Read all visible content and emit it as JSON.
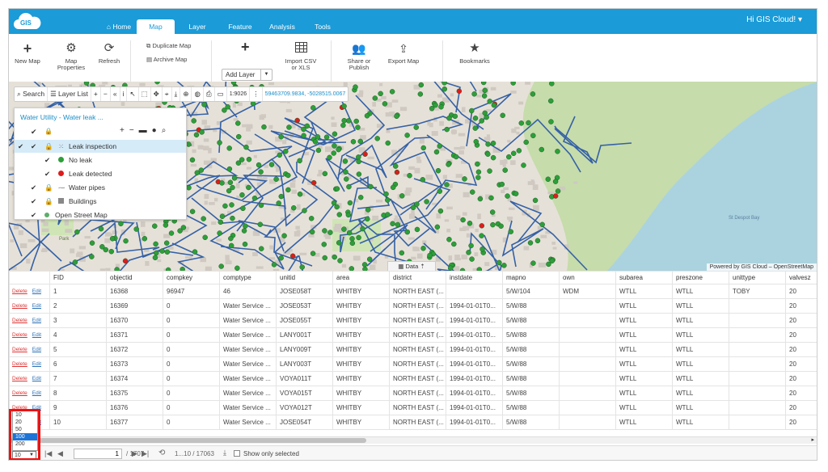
{
  "app": {
    "logo": "GIS",
    "user": "Hi GIS Cloud! ▾"
  },
  "nav": [
    {
      "label": "Home",
      "icon": "home-icon"
    },
    {
      "label": "Map"
    },
    {
      "label": "Layer"
    },
    {
      "label": "Feature"
    },
    {
      "label": "Analysis"
    },
    {
      "label": "Tools"
    }
  ],
  "ribbon": {
    "new_map": "New Map",
    "map_properties": "Map Properties",
    "refresh": "Refresh",
    "duplicate_map": "Duplicate Map",
    "archive_map": "Archive Map",
    "add_layer": "Add Layer",
    "import_csv": "Import CSV or XLS",
    "share": "Share or Publish",
    "export_map": "Export Map",
    "bookmarks": "Bookmarks"
  },
  "toolbar": {
    "search": "Search",
    "layer_list": "Layer List",
    "scale": "1:9026",
    "coords": "59463709.9834, -5028515.0067"
  },
  "layers": {
    "title": "Water Utility - Water leak ...",
    "items": [
      {
        "label": "Leak inspection"
      },
      {
        "label": "No leak",
        "color": "#2e9e3a"
      },
      {
        "label": "Leak detected",
        "color": "#dd1c1c"
      },
      {
        "label": "Water pipes"
      },
      {
        "label": "Buildings"
      },
      {
        "label": "Open Street Map"
      }
    ]
  },
  "map": {
    "credit": "Powered by GIS Cloud – OpenStreetMap",
    "data_tab": "Data",
    "park": "Park",
    "bay": "St Despot Bay"
  },
  "table": {
    "columns": [
      "FID",
      "objectid",
      "compkey",
      "comptype",
      "unitid",
      "area",
      "district",
      "instdate",
      "mapno",
      "own",
      "subarea",
      "preszone",
      "unittype",
      "valvesz"
    ],
    "actions": {
      "delete": "Delete",
      "edit": "Edit"
    },
    "rows": [
      [
        "1",
        "16368",
        "96947",
        "46",
        "JOSE058T",
        "WHITBY",
        "NORTH EAST (...",
        "",
        "5/W/104",
        "WDM",
        "WTLL",
        "WTLL",
        "TOBY",
        "20"
      ],
      [
        "2",
        "16369",
        "0",
        "Water Service ...",
        "JOSE053T",
        "WHITBY",
        "NORTH EAST (...",
        "1994-01-01T0...",
        "5/W/88",
        "",
        "WTLL",
        "WTLL",
        "",
        "20"
      ],
      [
        "3",
        "16370",
        "0",
        "Water Service ...",
        "JOSE055T",
        "WHITBY",
        "NORTH EAST (...",
        "1994-01-01T0...",
        "5/W/88",
        "",
        "WTLL",
        "WTLL",
        "",
        "20"
      ],
      [
        "4",
        "16371",
        "0",
        "Water Service ...",
        "LANY001T",
        "WHITBY",
        "NORTH EAST (...",
        "1994-01-01T0...",
        "5/W/88",
        "",
        "WTLL",
        "WTLL",
        "",
        "20"
      ],
      [
        "5",
        "16372",
        "0",
        "Water Service ...",
        "LANY009T",
        "WHITBY",
        "NORTH EAST (...",
        "1994-01-01T0...",
        "5/W/88",
        "",
        "WTLL",
        "WTLL",
        "",
        "20"
      ],
      [
        "6",
        "16373",
        "0",
        "Water Service ...",
        "LANY003T",
        "WHITBY",
        "NORTH EAST (...",
        "1994-01-01T0...",
        "5/W/88",
        "",
        "WTLL",
        "WTLL",
        "",
        "20"
      ],
      [
        "7",
        "16374",
        "0",
        "Water Service ...",
        "VOYA011T",
        "WHITBY",
        "NORTH EAST (...",
        "1994-01-01T0...",
        "5/W/88",
        "",
        "WTLL",
        "WTLL",
        "",
        "20"
      ],
      [
        "8",
        "16375",
        "0",
        "Water Service ...",
        "VOYA015T",
        "WHITBY",
        "NORTH EAST (...",
        "1994-01-01T0...",
        "5/W/88",
        "",
        "WTLL",
        "WTLL",
        "",
        "20"
      ],
      [
        "9",
        "16376",
        "0",
        "Water Service ...",
        "VOYA012T",
        "WHITBY",
        "NORTH EAST (...",
        "1994-01-01T0...",
        "5/W/88",
        "",
        "WTLL",
        "WTLL",
        "",
        "20"
      ],
      [
        "10",
        "16377",
        "0",
        "Water Service ...",
        "JOSE054T",
        "WHITBY",
        "NORTH EAST (...",
        "1994-01-01T0...",
        "5/W/88",
        "",
        "WTLL",
        "WTLL",
        "",
        "20"
      ]
    ]
  },
  "pager": {
    "page": "1",
    "total_pages": "/ 1707",
    "range": "1...10 / 17063",
    "show_selected": "Show only selected",
    "page_size": "10",
    "options": [
      "10",
      "20",
      "50",
      "100",
      "200"
    ],
    "highlighted": "100"
  },
  "colors": {
    "brand": "#1b9bd7",
    "no_leak": "#2e9e3a",
    "leak": "#dd1c1c",
    "pipe": "#2b5fa8",
    "water": "#a8d0e6",
    "forest": "#b9d7a0"
  }
}
